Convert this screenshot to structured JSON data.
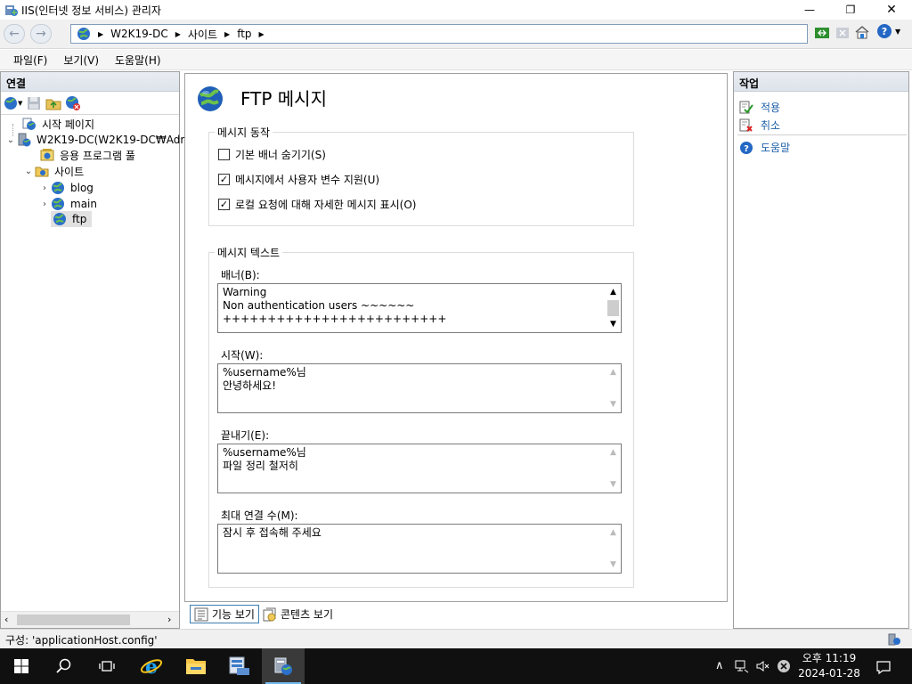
{
  "window": {
    "title": "IIS(인터넷 정보 서비스) 관리자",
    "minimize_glyph": "—",
    "maximize_glyph": "❐",
    "close_glyph": "✕"
  },
  "address": {
    "crumbs": [
      "W2K19-DC",
      "사이트",
      "ftp"
    ]
  },
  "menu": {
    "file": "파일(F)",
    "view": "보기(V)",
    "help": "도움말(H)"
  },
  "connections": {
    "header": "연결",
    "tree": {
      "start_page": "시작 페이지",
      "server": "W2K19-DC(W2K19-DC₩Adr",
      "app_pools": "응용 프로그램 풀",
      "sites": "사이트",
      "site_blog": "blog",
      "site_main": "main",
      "site_ftp": "ftp"
    }
  },
  "content": {
    "page_title": "FTP 메시지",
    "behavior_group": "메시지 동작",
    "checkboxes": [
      {
        "label": "기본 배너 숨기기(S)",
        "checked": false
      },
      {
        "label": "메시지에서 사용자 변수 지원(U)",
        "checked": true
      },
      {
        "label": "로컬 요청에 대해 자세한 메시지 표시(O)",
        "checked": true
      }
    ],
    "text_group": "메시지 텍스트",
    "fields": {
      "banner_label": "배너(B):",
      "banner_lines": [
        "Warning",
        "Non authentication users ~~~~~~",
        "+++++++++++++++++++++++++"
      ],
      "welcome_label": "시작(W):",
      "welcome_lines": [
        "%username%님",
        "안녕하세요!"
      ],
      "exit_label": "끝내기(E):",
      "exit_lines": [
        "%username%님",
        "파일 정리 철저히"
      ],
      "maxconn_label": "최대 연결 수(M):",
      "maxconn_lines": [
        "잠시 후 접속해 주세요"
      ]
    }
  },
  "view_tabs": {
    "features": "기능 보기",
    "content": "콘텐츠 보기"
  },
  "actions": {
    "header": "작업",
    "apply": "적용",
    "cancel": "취소",
    "help": "도움말"
  },
  "status": {
    "text": "구성: 'applicationHost.config'"
  },
  "taskbar": {
    "time": "오후 11:19",
    "date": "2024-01-28"
  },
  "colors": {
    "link": "#1e5fa8",
    "taskbar": "#101010"
  }
}
